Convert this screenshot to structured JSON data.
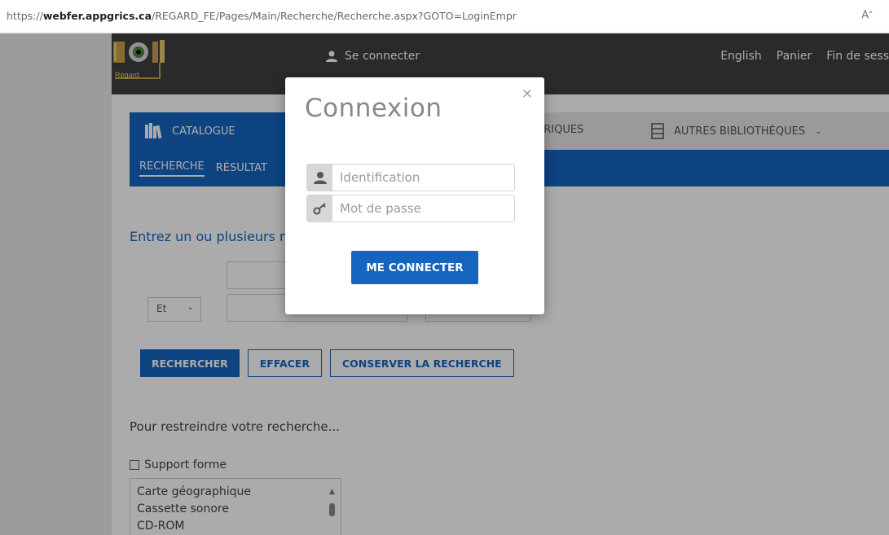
{
  "browser": {
    "url_prefix": "https://",
    "url_domain": "webfer.appgrics.ca",
    "url_path": "/REGARD_FE/Pages/Main/Recherche/Recherche.aspx?GOTO=LoginEmpr"
  },
  "header": {
    "logo_word": "Regard",
    "connect_label": "Se connecter",
    "links": [
      "English",
      "Panier",
      "Fin de sess"
    ]
  },
  "nav": {
    "catalogue": "CATALOGUE",
    "numeriques_partial": "ÉRIQUES",
    "autres": "AUTRES BIBLIOTHÈQUES",
    "sub_recherche": "RECHERCHE",
    "sub_resultats_partial": "RÉSULTAT"
  },
  "search": {
    "prompt_partial": "Entrez un ou plusieurs m",
    "operator": "Et",
    "buttons": {
      "search": "RECHERCHER",
      "clear": "EFFACER",
      "save": "CONSERVER LA RECHERCHE"
    },
    "restrict_label": "Pour restreindre votre recherche...",
    "support_label": "Support forme",
    "support_options": [
      "Carte géographique",
      "Cassette sonore",
      "CD-ROM"
    ]
  },
  "modal": {
    "title": "Connexion",
    "username_placeholder": "Identification",
    "password_placeholder": "Mot de passe",
    "submit_label": "ME CONNECTER",
    "close": "×"
  },
  "colors": {
    "primary": "#1565c0",
    "topbar": "#3f3f3f"
  }
}
